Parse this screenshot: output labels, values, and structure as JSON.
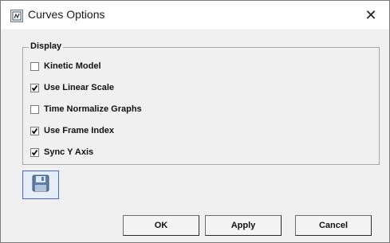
{
  "window": {
    "title": "Curves Options",
    "close_glyph": "✕",
    "icon": "app-icon"
  },
  "display_group": {
    "legend": "Display",
    "options": [
      {
        "label": "Kinetic Model",
        "checked": false
      },
      {
        "label": "Use Linear Scale",
        "checked": true
      },
      {
        "label": "Time Normalize Graphs",
        "checked": false
      },
      {
        "label": "Use Frame Index",
        "checked": true
      },
      {
        "label": "Sync Y Axis",
        "checked": true
      }
    ]
  },
  "toolbar": {
    "save_icon": "floppy-disk-icon"
  },
  "buttons": {
    "ok": "OK",
    "apply": "Apply",
    "cancel": "Cancel"
  }
}
